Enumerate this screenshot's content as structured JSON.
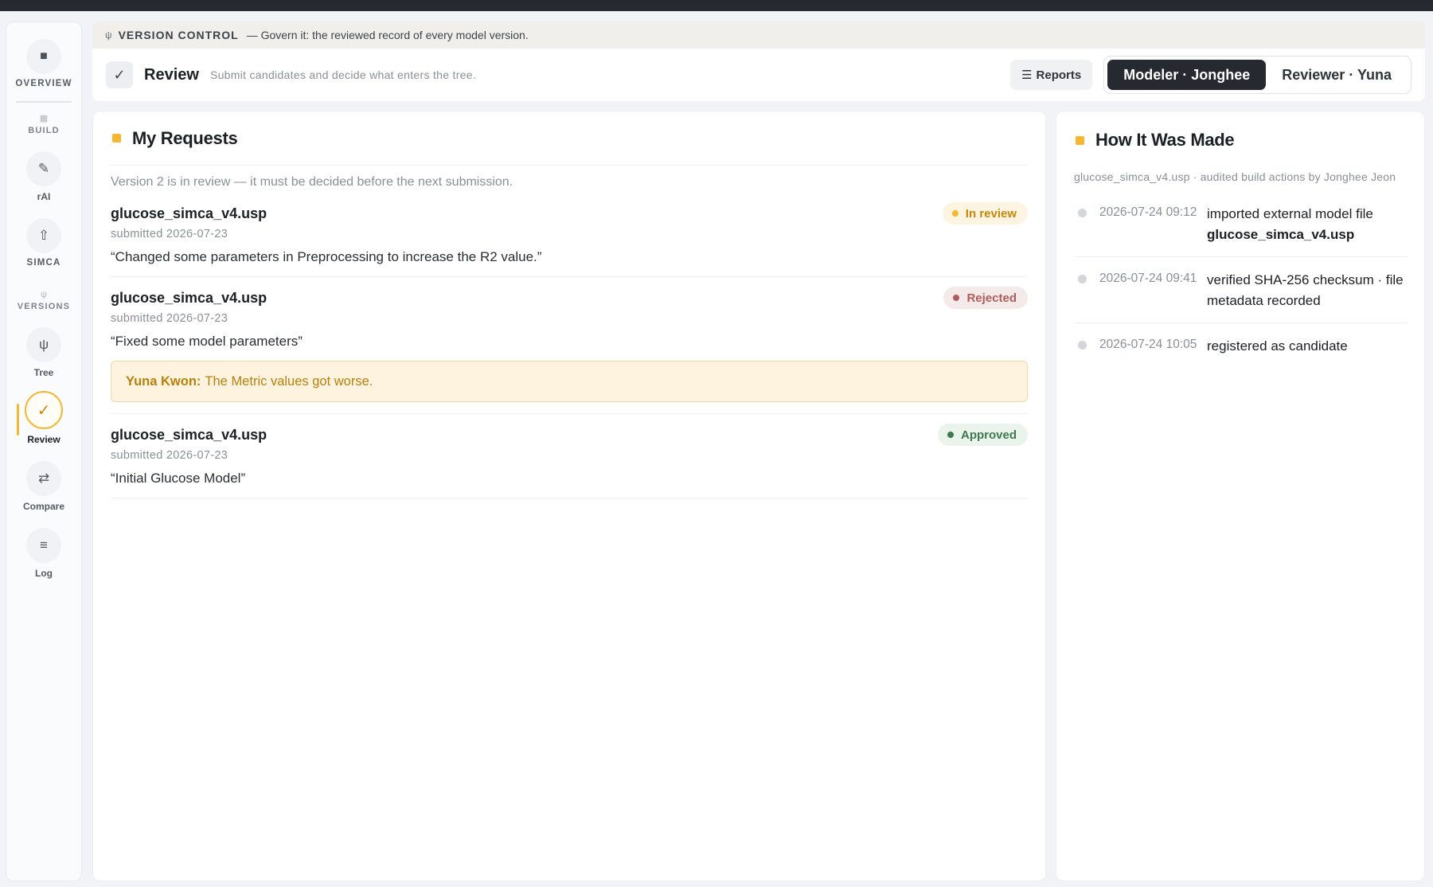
{
  "sidebar": {
    "overview": {
      "label": "OVERVIEW",
      "icon": "overview-grid-icon"
    },
    "build_group": {
      "label": "BUILD",
      "icon": "build-grid-icon"
    },
    "items_build": [
      {
        "label": "rAI",
        "icon": "pencil-icon"
      },
      {
        "label": "SIMCA",
        "icon": "upload-icon"
      }
    ],
    "versions_group": {
      "label": "VERSIONS",
      "icon": "branch-icon"
    },
    "items_versions": [
      {
        "label": "Tree",
        "icon": "branch-icon"
      },
      {
        "label": "Review",
        "icon": "check-icon",
        "active": true
      },
      {
        "label": "Compare",
        "icon": "arrows-swap-icon"
      },
      {
        "label": "Log",
        "icon": "list-icon"
      }
    ]
  },
  "banner": {
    "title": "VERSION CONTROL",
    "text": "— Govern it: the reviewed record of every model version."
  },
  "header": {
    "title": "Review",
    "subtitle": "Submit candidates and decide what enters the tree.",
    "reports_label": "Reports",
    "roles": [
      {
        "label": "Modeler · Jonghee",
        "active": true
      },
      {
        "label": "Reviewer · Yuna",
        "active": false
      }
    ]
  },
  "requests": {
    "title": "My Requests",
    "notice": "Version 2 is in review — it must be decided before the next submission.",
    "items": [
      {
        "file": "glucose_simca_v4.usp",
        "submitted": "submitted 2026-07-23",
        "message": "“Changed some parameters in Preprocessing to increase the R2 value.”",
        "status": "In review"
      },
      {
        "file": "glucose_simca_v4.usp",
        "submitted": "submitted 2026-07-23",
        "message": "“Fixed some model parameters”",
        "status": "Rejected",
        "feedback": {
          "author": "Yuna Kwon:",
          "text": "The Metric values got worse."
        }
      },
      {
        "file": "glucose_simca_v4.usp",
        "submitted": "submitted 2026-07-23",
        "message": "“Initial Glucose Model”",
        "status": "Approved"
      }
    ]
  },
  "made": {
    "title": "How It Was Made",
    "subtitle": "glucose_simca_v4.usp · audited build actions by Jonghee Jeon",
    "events": [
      {
        "time": "2026-07-24 09:12",
        "text": "imported external model file",
        "file": "glucose_simca_v4.usp"
      },
      {
        "time": "2026-07-24 09:41",
        "text": "verified SHA-256 checksum · file metadata recorded"
      },
      {
        "time": "2026-07-24 10:05",
        "text": "registered as candidate"
      }
    ]
  },
  "colors": {
    "accent": "#f5b731",
    "dark": "#262a30",
    "in_review": "#c9860a",
    "rejected": "#b15b5b",
    "approved": "#3e7a4f"
  }
}
